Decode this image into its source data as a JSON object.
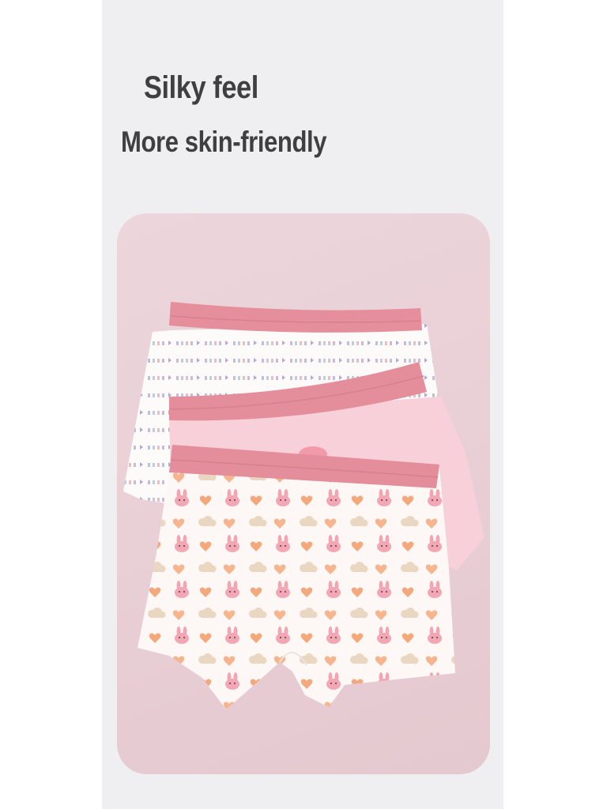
{
  "headline": {
    "line1": "Silky feel",
    "line2": "More skin-friendly"
  },
  "photo": {
    "subject": "three-pairs-kids-boxer-briefs",
    "colors": {
      "background": "#e8cfd5",
      "waistband": "#e58e9b",
      "pink_pair": "#f8cfd8",
      "print_base": "#fdf8f6",
      "print_pink": "#ef9aa8",
      "print_peach": "#f3a878",
      "print_beige": "#e7d3bd"
    }
  }
}
